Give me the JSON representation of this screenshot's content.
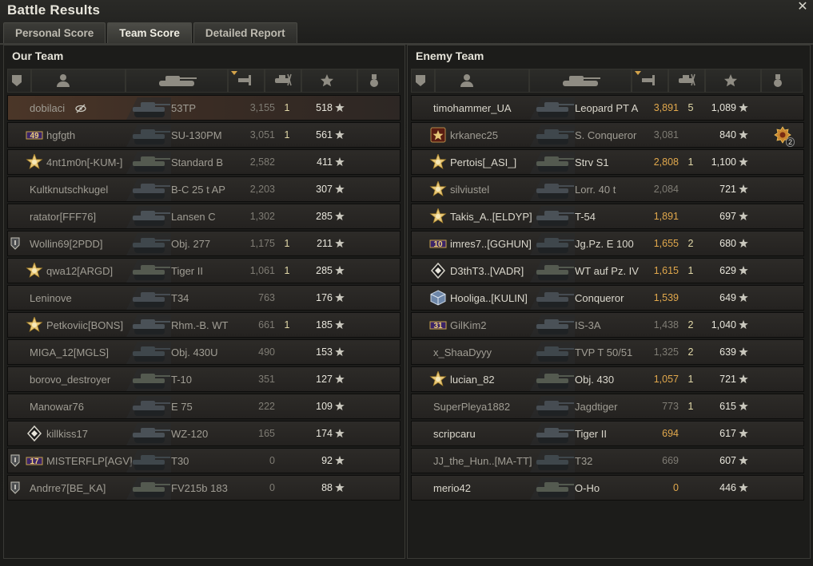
{
  "window": {
    "title": "Battle Results"
  },
  "tabs": [
    {
      "label": "Personal Score",
      "active": false
    },
    {
      "label": "Team Score",
      "active": true
    },
    {
      "label": "Detailed Report",
      "active": false
    }
  ],
  "columns": {
    "icons": [
      "platoon-icon",
      "player-icon",
      "tank-icon",
      "damage-icon",
      "kills-icon",
      "xp-star-icon",
      "medal-icon"
    ],
    "sorted_by": "damage"
  },
  "teams": {
    "our": {
      "title": "Our Team",
      "players": [
        {
          "name": "dobilaci",
          "vehicle": "53TP",
          "damage": "3,155",
          "kills": "1",
          "xp": "518",
          "highlight": true,
          "style": "dim",
          "hidden_icon": true
        },
        {
          "name": "hgfgth",
          "vehicle": "SU-130PM",
          "damage": "3,051",
          "kills": "1",
          "xp": "561",
          "badge": "49",
          "style": "dim"
        },
        {
          "name": "4nt1m0n[-KUM-]",
          "vehicle": "Standard B",
          "damage": "2,582",
          "kills": "",
          "xp": "411",
          "badge": "star",
          "style": "dim"
        },
        {
          "name": "Kultknutschkugel",
          "vehicle": "B-C 25 t AP",
          "damage": "2,203",
          "kills": "",
          "xp": "307",
          "style": "dim"
        },
        {
          "name": "ratator[FFF76]",
          "vehicle": "Lansen C",
          "damage": "1,302",
          "kills": "",
          "xp": "285",
          "style": "dim"
        },
        {
          "name": "Wollin69[2PDD]",
          "vehicle": "Obj. 277",
          "damage": "1,175",
          "kills": "1",
          "xp": "211",
          "platoon": true,
          "style": "dim"
        },
        {
          "name": "qwa12[ARGD]",
          "vehicle": "Tiger II",
          "damage": "1,061",
          "kills": "1",
          "xp": "285",
          "badge": "star",
          "style": "dim"
        },
        {
          "name": "Leninove",
          "vehicle": "T34",
          "damage": "763",
          "kills": "",
          "xp": "176",
          "style": "dim"
        },
        {
          "name": "Petkoviic[BONS]",
          "vehicle": "Rhm.-B. WT",
          "damage": "661",
          "kills": "1",
          "xp": "185",
          "badge": "star",
          "style": "dim"
        },
        {
          "name": "MIGA_12[MGLS]",
          "vehicle": "Obj. 430U",
          "damage": "490",
          "kills": "",
          "xp": "153",
          "style": "dim"
        },
        {
          "name": "borovo_destroyer",
          "vehicle": "T-10",
          "damage": "351",
          "kills": "",
          "xp": "127",
          "style": "dim"
        },
        {
          "name": "Manowar76",
          "vehicle": "E 75",
          "damage": "222",
          "kills": "",
          "xp": "109",
          "style": "dim"
        },
        {
          "name": "killkiss17",
          "vehicle": "WZ-120",
          "damage": "165",
          "kills": "",
          "xp": "174",
          "badge": "diamond",
          "style": "dim"
        },
        {
          "name": "MISTERFLP[AGV]",
          "vehicle": "T30",
          "damage": "0",
          "kills": "",
          "xp": "92",
          "badge": "17",
          "platoon": true,
          "style": "dim"
        },
        {
          "name": "Andrre7[BE_KA]",
          "vehicle": "FV215b 183",
          "damage": "0",
          "kills": "",
          "xp": "88",
          "platoon": true,
          "style": "dim"
        }
      ]
    },
    "enemy": {
      "title": "Enemy Team",
      "players": [
        {
          "name": "timohammer_UA",
          "vehicle": "Leopard PT A",
          "damage": "3,891",
          "kills": "5",
          "xp": "1,089",
          "style": "bright"
        },
        {
          "name": "krkanec25",
          "vehicle": "S. Conqueror",
          "damage": "3,081",
          "kills": "",
          "xp": "840",
          "badge": "red-star",
          "medal": "2",
          "style": "dim"
        },
        {
          "name": "Pertois[_ASI_]",
          "vehicle": "Strv S1",
          "damage": "2,808",
          "kills": "1",
          "xp": "1,100",
          "badge": "star",
          "style": "bright"
        },
        {
          "name": "silviustel",
          "vehicle": "Lorr. 40 t",
          "damage": "2,084",
          "kills": "",
          "xp": "721",
          "badge": "star",
          "style": "dim"
        },
        {
          "name": "Takis_A..[ELDYP]",
          "vehicle": "T-54",
          "damage": "1,891",
          "kills": "",
          "xp": "697",
          "badge": "star",
          "style": "bright"
        },
        {
          "name": "imres7..[GGHUN]",
          "vehicle": "Jg.Pz. E 100",
          "damage": "1,655",
          "kills": "2",
          "xp": "680",
          "badge": "10",
          "style": "bright"
        },
        {
          "name": "D3thT3..[VADR]",
          "vehicle": "WT auf Pz. IV",
          "damage": "1,615",
          "kills": "1",
          "xp": "629",
          "badge": "diamond",
          "style": "bright"
        },
        {
          "name": "Hooliga..[KULIN]",
          "vehicle": "Conqueror",
          "damage": "1,539",
          "kills": "",
          "xp": "649",
          "badge": "cube",
          "style": "bright"
        },
        {
          "name": "GilKim2",
          "vehicle": "IS-3A",
          "damage": "1,438",
          "kills": "2",
          "xp": "1,040",
          "badge": "31",
          "style": "dim"
        },
        {
          "name": "x_ShaaDyyy",
          "vehicle": "TVP T 50/51",
          "damage": "1,325",
          "kills": "2",
          "xp": "639",
          "style": "dim"
        },
        {
          "name": "lucian_82",
          "vehicle": "Obj. 430",
          "damage": "1,057",
          "kills": "1",
          "xp": "721",
          "badge": "star",
          "style": "bright"
        },
        {
          "name": "SuperPleya1882",
          "vehicle": "Jagdtiger",
          "damage": "773",
          "kills": "1",
          "xp": "615",
          "style": "dim"
        },
        {
          "name": "scripcaru",
          "vehicle": "Tiger II",
          "damage": "694",
          "kills": "",
          "xp": "617",
          "style": "bright"
        },
        {
          "name": "JJ_the_Hun..[MA-TT]",
          "vehicle": "T32",
          "damage": "669",
          "kills": "",
          "xp": "607",
          "style": "dim"
        },
        {
          "name": "merio42",
          "vehicle": "O-Ho",
          "damage": "0",
          "kills": "",
          "xp": "446",
          "style": "bright"
        }
      ]
    }
  },
  "colors": {
    "damage_highlight": "#e1a84c",
    "row_highlight": "#4b3628",
    "sort_marker": "#d3a34a"
  }
}
